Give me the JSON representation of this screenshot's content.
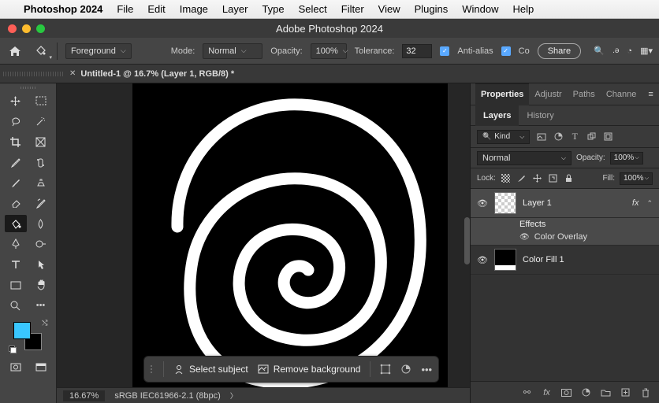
{
  "menubar": {
    "app": "Photoshop 2024",
    "items": [
      "File",
      "Edit",
      "Image",
      "Layer",
      "Type",
      "Select",
      "Filter",
      "View",
      "Plugins",
      "Window",
      "Help"
    ]
  },
  "titlebar": {
    "title": "Adobe Photoshop 2024"
  },
  "optionsbar": {
    "fill_src": "Foreground",
    "mode_label": "Mode:",
    "mode": "Normal",
    "opacity_label": "Opacity:",
    "opacity": "100%",
    "tolerance_label": "Tolerance:",
    "tolerance": "32",
    "antialias": "Anti-alias",
    "contiguous": "Co",
    "share": "Share"
  },
  "tabs": {
    "doc": "Untitled-1 @ 16.7% (Layer 1, RGB/8) *"
  },
  "contextbar": {
    "select_subject": "Select subject",
    "remove_bg": "Remove background"
  },
  "statusbar": {
    "zoom": "16.67%",
    "profile": "sRGB IEC61966-2.1 (8bpc)"
  },
  "panels": {
    "tabs": {
      "properties": "Properties",
      "adjust": "Adjustr",
      "paths": "Paths",
      "channels": "Channe"
    },
    "subtabs": {
      "layers": "Layers",
      "history": "History"
    },
    "kind": "Kind",
    "blend_mode": "Normal",
    "opacity_label": "Opacity:",
    "opacity": "100%",
    "lock_label": "Lock:",
    "fill_label": "Fill:",
    "fill": "100%",
    "layers": [
      {
        "name": "Layer 1",
        "selected": true,
        "fx": true
      },
      {
        "name": "Color Fill 1",
        "selected": false,
        "fx": false
      }
    ],
    "effects_title": "Effects",
    "effect_item": "Color Overlay"
  },
  "colors": {
    "foreground": "#39c7ff",
    "background": "#000000"
  }
}
